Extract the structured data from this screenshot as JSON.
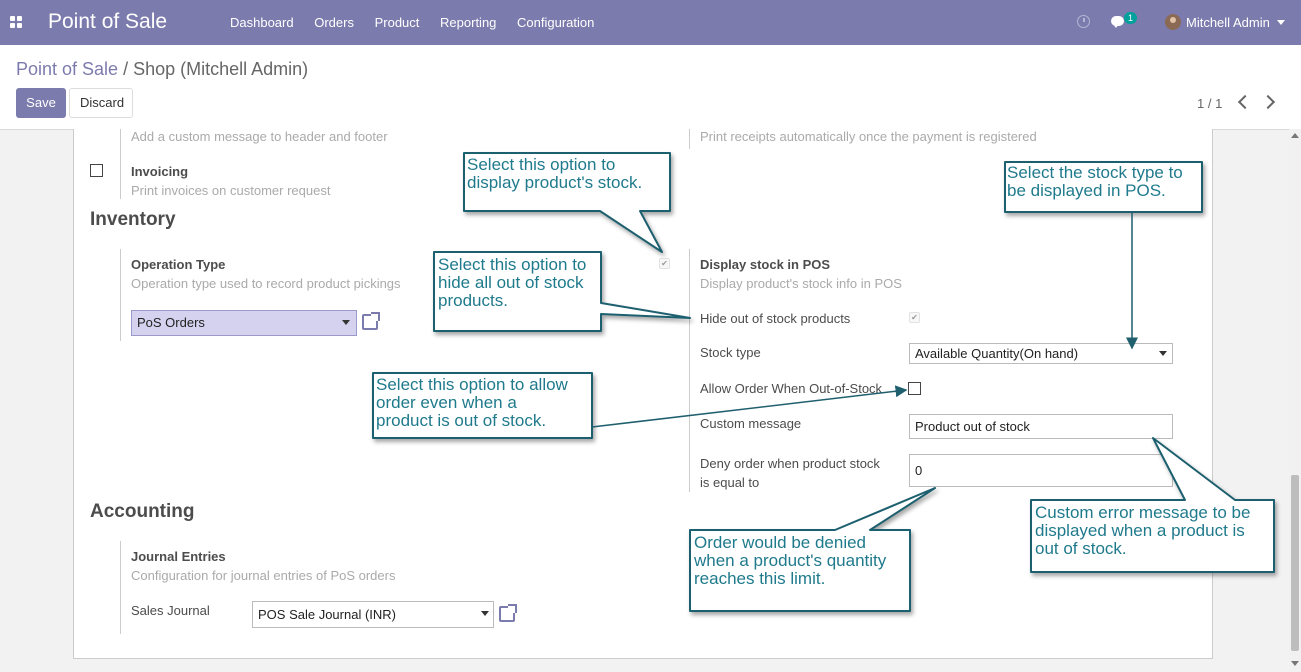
{
  "nav": {
    "app_title": "Point of Sale",
    "menu": [
      "Dashboard",
      "Orders",
      "Product",
      "Reporting",
      "Configuration"
    ],
    "message_count": "1",
    "user_name": "Mitchell Admin"
  },
  "breadcrumb": {
    "parent": "Point of Sale",
    "separator": "/",
    "current": "Shop (Mitchell Admin)"
  },
  "buttons": {
    "save": "Save",
    "discard": "Discard"
  },
  "pager": "1 / 1",
  "top": {
    "header_footer_desc": "Add a custom message to header and footer",
    "auto_print_desc": "Print receipts automatically once the payment is registered",
    "invoicing_title": "Invoicing",
    "invoicing_desc": "Print invoices on customer request"
  },
  "inventory": {
    "heading": "Inventory",
    "op_type_title": "Operation Type",
    "op_type_desc": "Operation type used to record product pickings",
    "op_type_value": "PoS Orders",
    "stock_title": "Display stock in POS",
    "stock_desc": "Display product's stock info in POS",
    "hide_out_label": "Hide out of stock products",
    "stock_type_label": "Stock type",
    "stock_type_value": "Available Quantity(On hand)",
    "allow_order_label": "Allow Order When Out-of-Stock",
    "custom_msg_label": "Custom message",
    "custom_msg_value": "Product out of stock",
    "deny_label_1": "Deny order when product stock",
    "deny_label_2": "is equal to",
    "deny_value": "0"
  },
  "accounting": {
    "heading": "Accounting",
    "journal_title": "Journal Entries",
    "journal_desc": "Configuration for journal entries of PoS orders",
    "sales_journal_label": "Sales Journal",
    "sales_journal_value": "POS Sale Journal (INR)"
  },
  "callouts": {
    "display_stock": [
      "Select this option to",
      "display product's stock."
    ],
    "stock_type": [
      "Select the stock type to",
      "be displayed in POS."
    ],
    "hide_out": [
      "Select this option to",
      "hide all out of stock",
      "products."
    ],
    "allow_order": [
      "Select this option to allow",
      "order even when a",
      "product is out of stock."
    ],
    "custom_error": [
      "Custom error message to be",
      "displayed when a product is",
      "out of stock."
    ],
    "deny_order": [
      "Order would be denied",
      "when a product's quantity",
      "reaches this limit."
    ]
  },
  "colors": {
    "navbar": "#7c7bad",
    "callout_text": "#1f7a8c",
    "callout_border": "#1f5f6e"
  }
}
